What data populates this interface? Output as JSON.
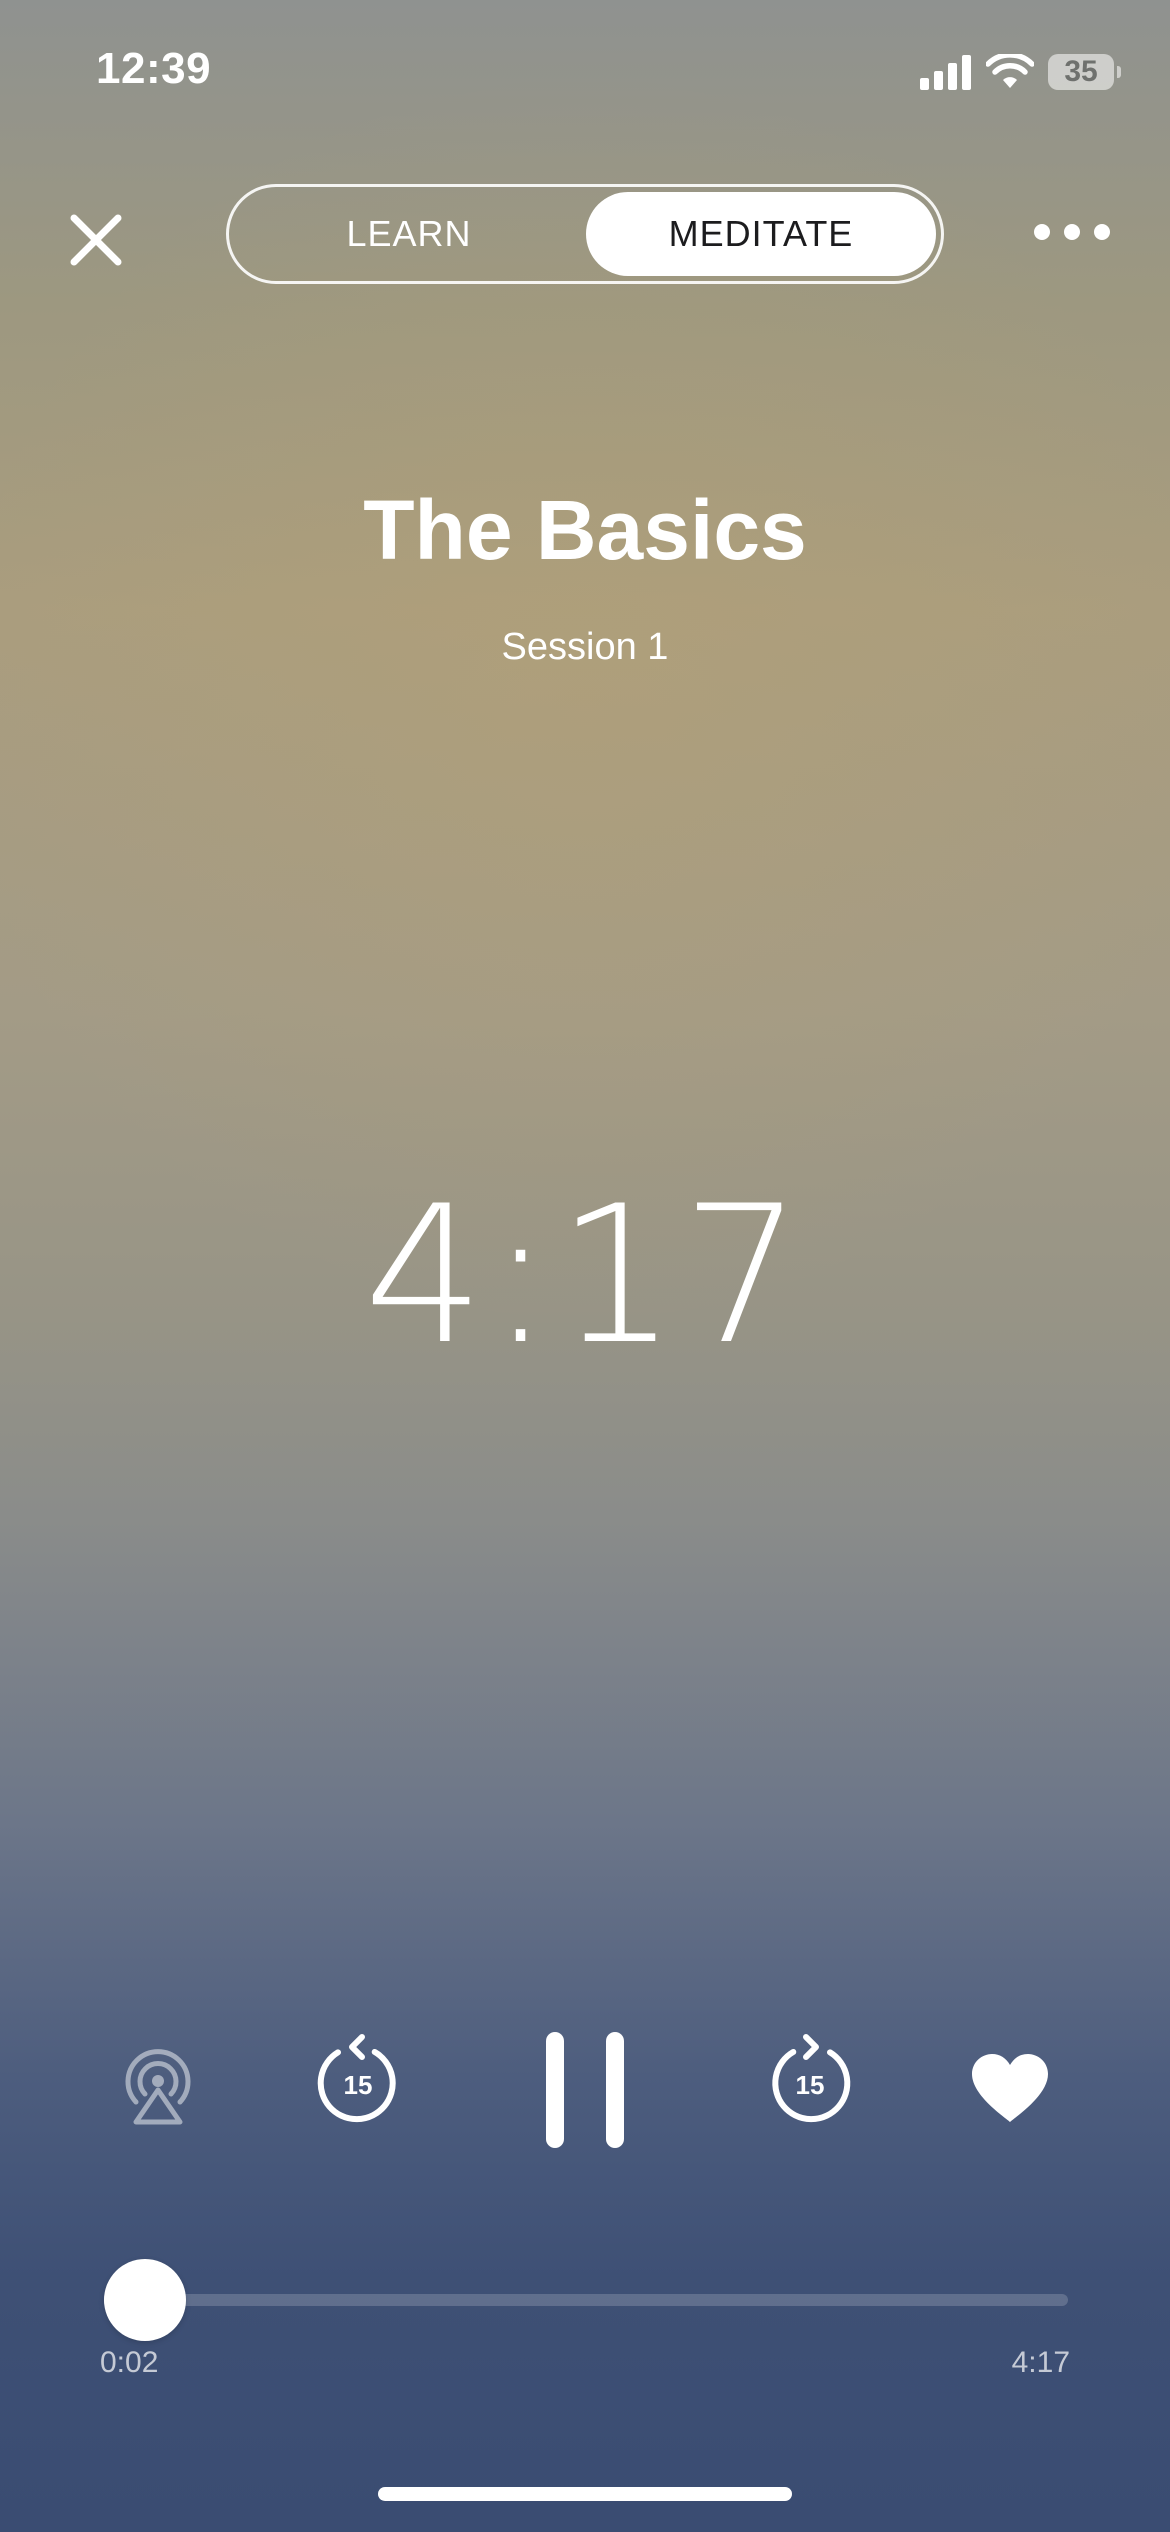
{
  "status_bar": {
    "time": "12:39",
    "battery": "35",
    "icons": [
      "signal-icon",
      "wifi-icon",
      "battery-icon"
    ]
  },
  "header": {
    "tabs": [
      {
        "label": "LEARN",
        "selected": false
      },
      {
        "label": "MEDITATE",
        "selected": true
      }
    ],
    "icons": [
      "close-icon",
      "more-icon"
    ]
  },
  "session": {
    "title": "The Basics",
    "subtitle": "Session 1",
    "remaining": "4:17"
  },
  "controls": {
    "rewind_label": "15",
    "forward_label": "15",
    "icons": [
      "airplay-icon",
      "rewind-15-icon",
      "pause-icon",
      "forward-15-icon",
      "heart-icon"
    ]
  },
  "progress": {
    "elapsed": "0:02",
    "total": "4:17",
    "fraction": 0.0078
  },
  "colors": {
    "background_top": "#8f9290",
    "background_mid": "#aa9d7e",
    "background_bottom": "#3a4c72",
    "accent": "#ffffff"
  }
}
